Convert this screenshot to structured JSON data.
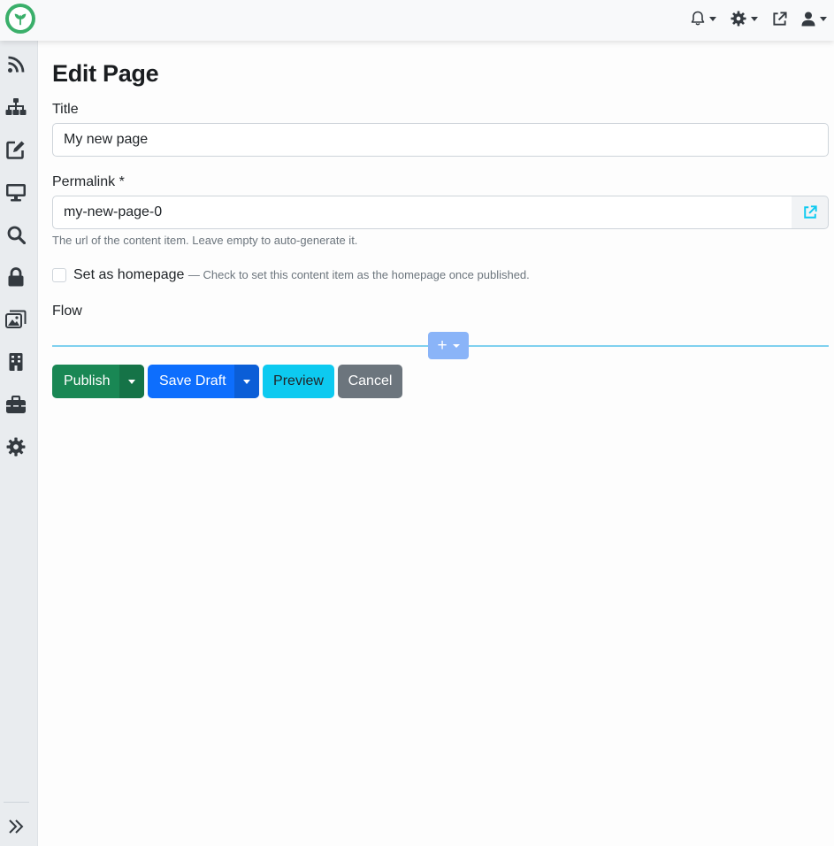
{
  "topbar": {
    "logo_icon": "leaf-logo",
    "icons": [
      "bell-icon",
      "gear-icon",
      "external-link-icon",
      "user-icon"
    ]
  },
  "sidebar": {
    "items": [
      {
        "icon": "rss-icon"
      },
      {
        "icon": "sitemap-icon"
      },
      {
        "icon": "edit-icon"
      },
      {
        "icon": "desktop-icon"
      },
      {
        "icon": "search-icon"
      },
      {
        "icon": "lock-icon"
      },
      {
        "icon": "images-icon"
      },
      {
        "icon": "building-icon"
      },
      {
        "icon": "toolbox-icon"
      },
      {
        "icon": "gear-icon"
      }
    ],
    "expand_icon": "double-chevron-right-icon"
  },
  "page": {
    "heading": "Edit Page",
    "title_label": "Title",
    "title_value": "My new page",
    "permalink_label": "Permalink *",
    "permalink_value": "my-new-page-0",
    "permalink_help": "The url of the content item. Leave empty to auto-generate it.",
    "homepage_label": "Set as homepage",
    "homepage_hint": "— Check to set this content item as the homepage once published.",
    "flow_label": "Flow"
  },
  "actions": {
    "publish": "Publish",
    "save_draft": "Save Draft",
    "preview": "Preview",
    "cancel": "Cancel"
  },
  "colors": {
    "publish": "#198754",
    "publish_dark": "#157347",
    "save_draft": "#0d6efd",
    "save_draft_dark": "#0b5ed7",
    "preview": "#0dcaf0",
    "cancel": "#6c757d",
    "accent_line": "#7fd1ef",
    "flow_button": "#8ab4f8"
  }
}
